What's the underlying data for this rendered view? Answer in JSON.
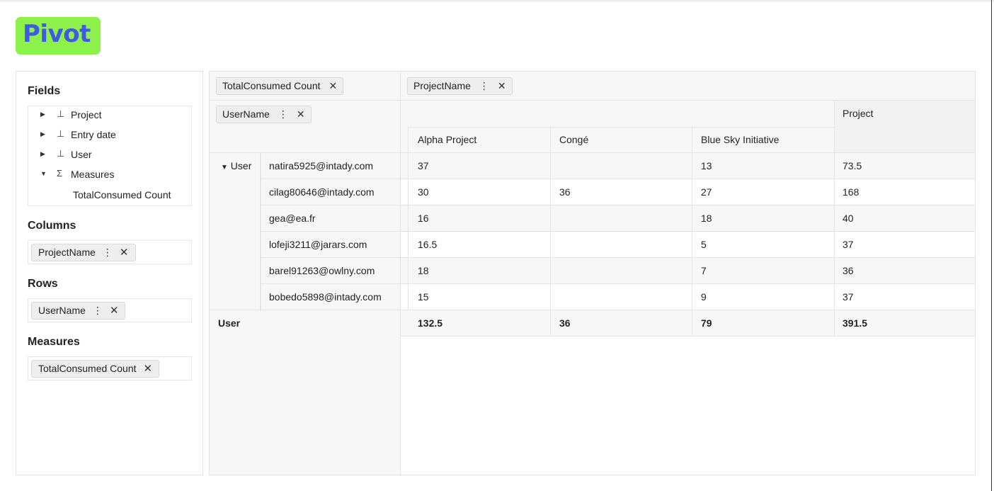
{
  "app": {
    "logo": "Pivot"
  },
  "sidebar": {
    "fields_title": "Fields",
    "fields": [
      {
        "label": "Project",
        "icon": "hierarchy-icon",
        "expanded": false
      },
      {
        "label": "Entry date",
        "icon": "hierarchy-icon",
        "expanded": false
      },
      {
        "label": "User",
        "icon": "hierarchy-icon",
        "expanded": false
      },
      {
        "label": "Measures",
        "icon": "sigma-icon",
        "expanded": true
      }
    ],
    "measure_leaf": "TotalConsumed Count",
    "columns_title": "Columns",
    "columns_pill": "ProjectName",
    "rows_title": "Rows",
    "rows_pill": "UserName",
    "measures_title": "Measures",
    "measures_pill": "TotalConsumed Count"
  },
  "pivot": {
    "measure_pill": "TotalConsumed Count",
    "column_pill": "ProjectName",
    "row_pill": "UserName",
    "column_total_label": "Project",
    "columns": [
      "Alpha Project",
      "Congé",
      "Blue Sky Initiative"
    ],
    "row_group_label": "User",
    "rows": [
      {
        "user": "natira5925@intady.com",
        "values": [
          "37",
          "",
          "13"
        ],
        "total": "73.5"
      },
      {
        "user": "cilag80646@intady.com",
        "values": [
          "30",
          "36",
          "27"
        ],
        "total": "168"
      },
      {
        "user": "gea@ea.fr",
        "values": [
          "16",
          "",
          "18"
        ],
        "total": "40"
      },
      {
        "user": "lofeji3211@jarars.com",
        "values": [
          "16.5",
          "",
          "5"
        ],
        "total": "37"
      },
      {
        "user": "barel91263@owlny.com",
        "values": [
          "18",
          "",
          "7"
        ],
        "total": "36"
      },
      {
        "user": "bobedo5898@intady.com",
        "values": [
          "15",
          "",
          "9"
        ],
        "total": "37"
      }
    ],
    "total_label": "User",
    "totals": [
      "132.5",
      "36",
      "79"
    ],
    "grand_total": "391.5"
  }
}
